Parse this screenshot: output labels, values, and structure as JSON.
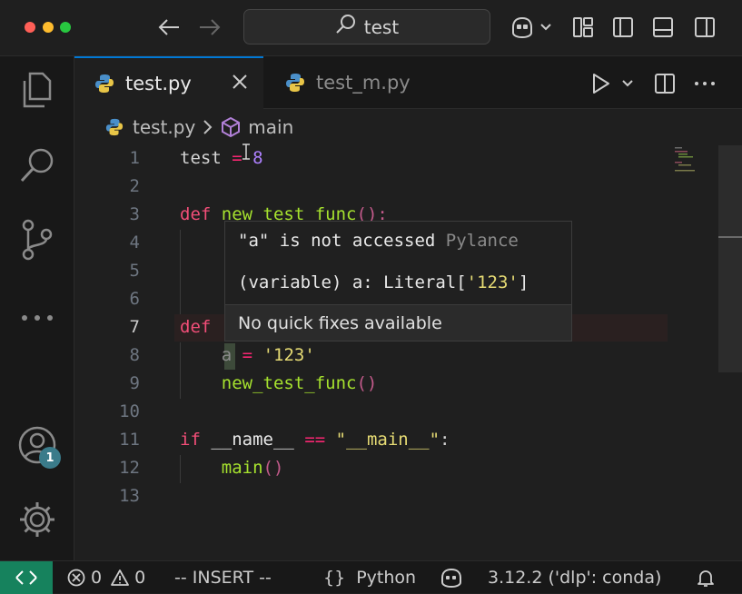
{
  "window": {
    "search": {
      "text": "test"
    }
  },
  "tabs": [
    {
      "label": "test.py",
      "active": true
    },
    {
      "label": "test_m.py",
      "active": false
    }
  ],
  "breadcrumb": {
    "file": "test.py",
    "symbol": "main"
  },
  "line_numbers": [
    "1",
    "2",
    "3",
    "4",
    "5",
    "6",
    "7",
    "8",
    "9",
    "10",
    "11",
    "12",
    "13"
  ],
  "active_line": "7",
  "code": {
    "l1_name": "test",
    "l1_op": "=",
    "l1_num": "8",
    "l3_kw": "def",
    "l3_fn": "new_test_func",
    "l3_paren": "():",
    "l7_kw": "def",
    "l8_var": "a",
    "l8_op": "=",
    "l8_str": "'123'",
    "l9_fn": "new_test_func",
    "l9_paren": "()",
    "l11_kw": "if",
    "l11_name": "__name__",
    "l11_op": "==",
    "l11_str": "\"__main__\"",
    "l11_colon": ":",
    "l12_fn": "main",
    "l12_paren": "()"
  },
  "hover": {
    "title": "\"a\" is not accessed",
    "source": "Pylance",
    "sig_open": "(variable) a: Literal[",
    "sig_str": "'123'",
    "sig_close": "]",
    "footer": "No quick fixes available"
  },
  "status": {
    "errors": "0",
    "warnings": "0",
    "mode": "-- INSERT --",
    "language_icon": "{}",
    "language": "Python",
    "interpreter": "3.12.2 ('dlp': conda)"
  },
  "activity": {
    "accounts_badge": "1"
  },
  "colors": {
    "accent": "#0078d4",
    "remote": "#16825d",
    "keyword": "#f24e78",
    "function": "#a6e22e",
    "string": "#e6db74",
    "number": "#ae81ff"
  }
}
